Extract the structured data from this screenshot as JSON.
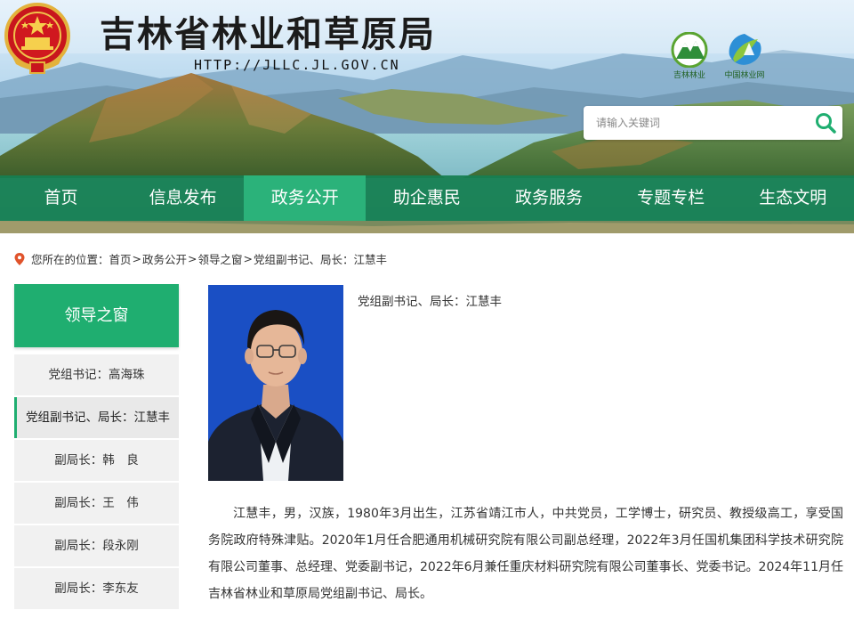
{
  "header": {
    "title": "吉林省林业和草原局",
    "url": "HTTP://JLLC.JL.GOV.CN",
    "logos": [
      {
        "caption": "吉林林业",
        "icon": "jilin-forestry-logo"
      },
      {
        "caption": "中国林业网",
        "icon": "china-forestry-logo"
      }
    ],
    "search": {
      "placeholder": "请输入关键词",
      "icon": "search-icon"
    }
  },
  "nav": {
    "items": [
      {
        "label": "首页"
      },
      {
        "label": "信息发布"
      },
      {
        "label": "政务公开",
        "active": true
      },
      {
        "label": "助企惠民"
      },
      {
        "label": "政务服务"
      },
      {
        "label": "专题专栏"
      },
      {
        "label": "生态文明"
      }
    ]
  },
  "breadcrumb": {
    "prefix": "您所在的位置：",
    "items": [
      "首页",
      "政务公开",
      "领导之窗",
      "党组副书记、局长：江慧丰"
    ],
    "separator": ">"
  },
  "sidebar": {
    "title": "领导之窗",
    "items": [
      {
        "label": "党组书记：高海珠"
      },
      {
        "label": "党组副书记、局长：江慧丰",
        "active": true
      },
      {
        "label": "副局长：韩　良"
      },
      {
        "label": "副局长：王　伟"
      },
      {
        "label": "副局长：段永刚"
      },
      {
        "label": "副局长：李东友"
      }
    ]
  },
  "main": {
    "person_title": "党组副书记、局长：江慧丰",
    "bio": "江慧丰，男，汉族，1980年3月出生，江苏省靖江市人，中共党员，工学博士，研究员、教授级高工，享受国务院政府特殊津贴。2020年1月任合肥通用机械研究院有限公司副总经理，2022年3月任国机集团科学技术研究院有限公司董事、总经理、党委副书记，2022年6月兼任重庆材料研究院有限公司董事长、党委书记。2024年11月任吉林省林业和草原局党组副书记、局长。"
  },
  "colors": {
    "nav_bg": "#168052",
    "nav_active": "#2bb27a",
    "accent": "#1fae70",
    "photo_bg": "#1a4fc4"
  }
}
